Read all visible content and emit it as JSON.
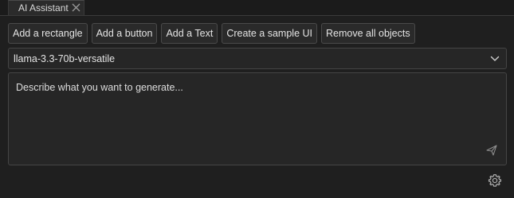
{
  "window": {
    "tab_title": "AI Assistant"
  },
  "toolbar": {
    "buttons": [
      {
        "label": "Add a rectangle"
      },
      {
        "label": "Add a button"
      },
      {
        "label": "Add a Text"
      },
      {
        "label": "Create a sample UI"
      },
      {
        "label": "Remove all objects"
      }
    ]
  },
  "model_select": {
    "selected": "llama-3.3-70b-versatile"
  },
  "prompt": {
    "placeholder": "Describe what you want to generate..."
  },
  "icons": {
    "tab_close": "close-icon",
    "dropdown": "chevron-down-icon",
    "send": "send-icon",
    "settings": "gear-icon"
  },
  "colors": {
    "background": "#1f1f1f",
    "control_bg": "#2a2a2a",
    "border": "#4a4a4a",
    "text": "#e4e4e4",
    "icon": "#a8a8a8"
  }
}
